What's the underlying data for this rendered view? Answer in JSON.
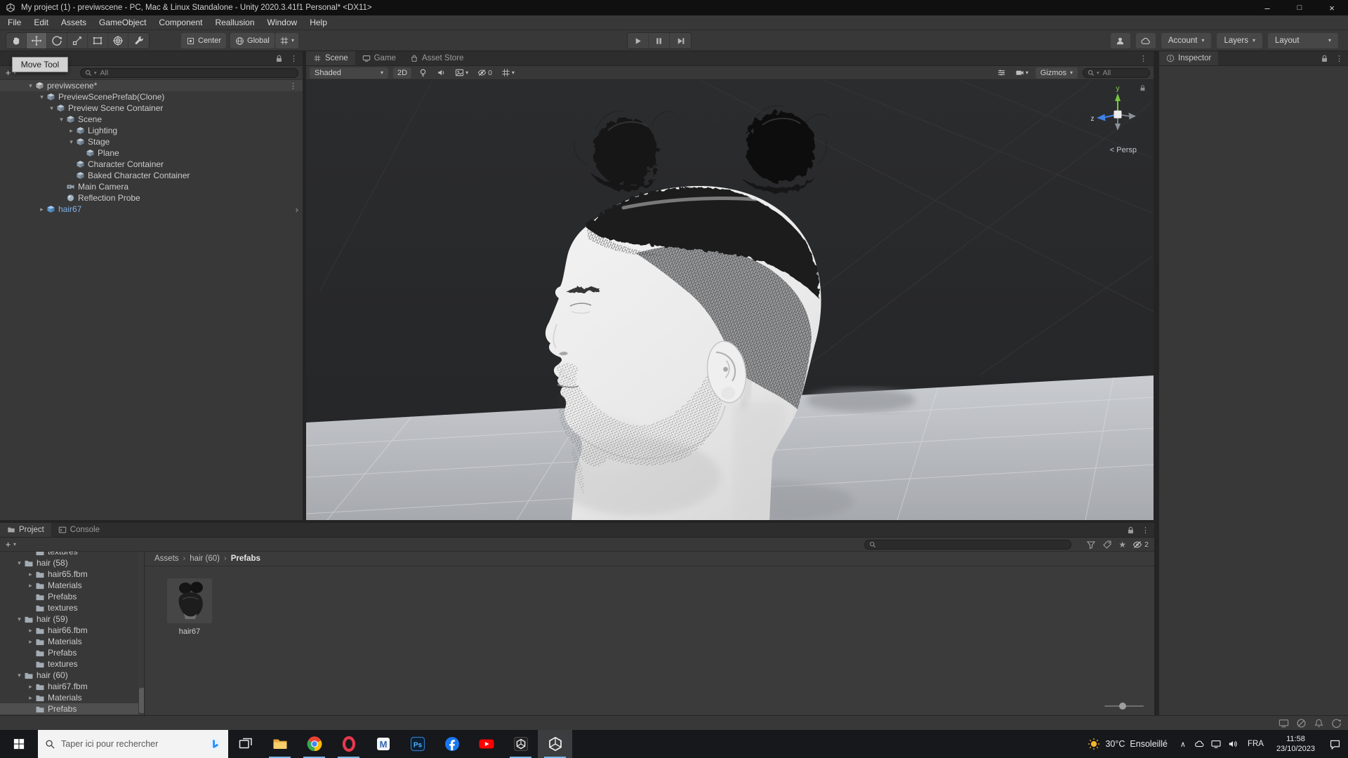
{
  "colors": {
    "panel_bg": "#383838",
    "viewport_bg": "#28292b",
    "plane_gray": "#b8bbbf",
    "prefab_text": "#7fb0e8",
    "selection_gray": "#4f4f4f",
    "axis_y_green": "#76c83e",
    "axis_z_blue": "#3f81e9",
    "taskbar_bg": "#16181b",
    "running_indicator": "#7ab8e8"
  },
  "window": {
    "title": "My project (1) - previwscene - PC, Mac & Linux Standalone - Unity 2020.3.41f1 Personal* <DX11>"
  },
  "menubar": {
    "items": [
      {
        "label": "File"
      },
      {
        "label": "Edit"
      },
      {
        "label": "Assets"
      },
      {
        "label": "GameObject"
      },
      {
        "label": "Component"
      },
      {
        "label": "Reallusion"
      },
      {
        "label": "Window"
      },
      {
        "label": "Help"
      }
    ]
  },
  "main_toolbar": {
    "tools": [
      {
        "name": "hand",
        "selected": false
      },
      {
        "name": "move",
        "selected": true
      },
      {
        "name": "rotate",
        "selected": false
      },
      {
        "name": "scale",
        "selected": false
      },
      {
        "name": "rect",
        "selected": false
      },
      {
        "name": "transform",
        "selected": false
      },
      {
        "name": "custom",
        "selected": false
      }
    ],
    "pivot_label": "Center",
    "orientation_label": "Global",
    "account_label": "Account",
    "layers_label": "Layers",
    "layout_label": "Layout"
  },
  "tooltip": {
    "text": "Move Tool"
  },
  "hierarchy": {
    "search_scope": "All",
    "items": [
      {
        "label": "previwscene*",
        "level": 0,
        "arrow": "down",
        "icon": "scene",
        "header": true,
        "kebab": true
      },
      {
        "label": "PreviewScenePrefab(Clone)",
        "level": 1,
        "arrow": "down",
        "icon": "cube"
      },
      {
        "label": "Preview Scene Container",
        "level": 2,
        "arrow": "down",
        "icon": "cube"
      },
      {
        "label": "Scene",
        "level": 3,
        "arrow": "down",
        "icon": "cube"
      },
      {
        "label": "Lighting",
        "level": 4,
        "arrow": "right",
        "icon": "cube"
      },
      {
        "label": "Stage",
        "level": 4,
        "arrow": "down",
        "icon": "cube"
      },
      {
        "label": "Plane",
        "level": 5,
        "icon": "cube"
      },
      {
        "label": "Character Container",
        "level": 4,
        "icon": "cube"
      },
      {
        "label": "Baked Character Container",
        "level": 4,
        "icon": "cube"
      },
      {
        "label": "Main Camera",
        "level": 3,
        "icon": "camera"
      },
      {
        "label": "Reflection Probe",
        "level": 3,
        "icon": "probe"
      },
      {
        "label": "hair67",
        "level": 1,
        "arrow": "right",
        "icon": "prefab",
        "blue": true,
        "chevron": true
      }
    ]
  },
  "scene_view": {
    "tabs": [
      {
        "label": "Scene",
        "active": true
      },
      {
        "label": "Game",
        "active": false
      },
      {
        "label": "Asset Store",
        "active": false
      }
    ],
    "toolbar": {
      "draw_mode": "Shaded",
      "mode_2d": "2D",
      "hidden_count": "0",
      "gizmos_label": "Gizmos",
      "search_scope": "All"
    },
    "overlay": {
      "axis_y": "y",
      "axis_z": "z",
      "projection": "< Persp"
    }
  },
  "inspector": {
    "title": "Inspector"
  },
  "project": {
    "tabs": [
      {
        "label": "Project",
        "active": true
      },
      {
        "label": "Console",
        "active": false
      }
    ],
    "hidden_count": "2",
    "breadcrumb": [
      "Assets",
      "hair (60)",
      "Prefabs"
    ],
    "tree": [
      {
        "label": "textures",
        "level": 2,
        "icon": "folder"
      },
      {
        "label": "hair (58)",
        "level": 1,
        "arrow": "down",
        "icon": "folder"
      },
      {
        "label": "hair65.fbm",
        "level": 2,
        "arrow": "right",
        "icon": "folder"
      },
      {
        "label": "Materials",
        "level": 2,
        "arrow": "right",
        "icon": "folder"
      },
      {
        "label": "Prefabs",
        "level": 2,
        "icon": "folder"
      },
      {
        "label": "textures",
        "level": 2,
        "icon": "folder"
      },
      {
        "label": "hair (59)",
        "level": 1,
        "arrow": "down",
        "icon": "folder"
      },
      {
        "label": "hair66.fbm",
        "level": 2,
        "arrow": "right",
        "icon": "folder"
      },
      {
        "label": "Materials",
        "level": 2,
        "arrow": "right",
        "icon": "folder"
      },
      {
        "label": "Prefabs",
        "level": 2,
        "icon": "folder"
      },
      {
        "label": "textures",
        "level": 2,
        "icon": "folder"
      },
      {
        "label": "hair (60)",
        "level": 1,
        "arrow": "down",
        "icon": "folder"
      },
      {
        "label": "hair67.fbm",
        "level": 2,
        "arrow": "right",
        "icon": "folder"
      },
      {
        "label": "Materials",
        "level": 2,
        "arrow": "right",
        "icon": "folder"
      },
      {
        "label": "Prefabs",
        "level": 2,
        "icon": "folder",
        "selected": true
      }
    ],
    "assets": [
      {
        "label": "hair67"
      }
    ]
  },
  "taskbar": {
    "search": {
      "placeholder": "Taper ici pour rechercher"
    },
    "apps": [
      {
        "name": "task-view",
        "running": false
      },
      {
        "name": "file-explorer",
        "running": true
      },
      {
        "name": "chrome",
        "running": true
      },
      {
        "name": "opera",
        "running": true
      },
      {
        "name": "m-app",
        "running": false
      },
      {
        "name": "photoshop",
        "running": false
      },
      {
        "name": "facebook",
        "running": false
      },
      {
        "name": "youtube",
        "running": false
      },
      {
        "name": "unity-hub",
        "running": true
      },
      {
        "name": "unity",
        "running": true,
        "active": true
      }
    ],
    "weather": {
      "temperature": "30°C",
      "condition": "Ensoleillé"
    },
    "language": "FRA",
    "clock": {
      "time": "11:58",
      "date": "23/10/2023"
    }
  }
}
